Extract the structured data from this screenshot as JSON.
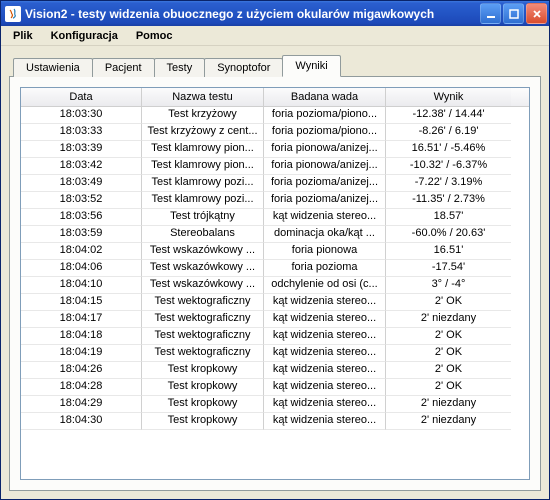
{
  "window": {
    "title": "Vision2 - testy widzenia obuocznego z użyciem okularów migawkowych"
  },
  "menubar": {
    "items": [
      "Plik",
      "Konfiguracja",
      "Pomoc"
    ]
  },
  "tabs": {
    "items": [
      "Ustawienia",
      "Pacjent",
      "Testy",
      "Synoptofor",
      "Wyniki"
    ],
    "activeIndex": 4
  },
  "table": {
    "columns": [
      "Data",
      "Nazwa testu",
      "Badana wada",
      "Wynik"
    ],
    "rows": [
      [
        "18:03:30",
        "Test krzyżowy",
        "foria pozioma/piono...",
        "-12.38' / 14.44'"
      ],
      [
        "18:03:33",
        "Test krzyżowy z cent...",
        "foria pozioma/piono...",
        "-8.26' / 6.19'"
      ],
      [
        "18:03:39",
        "Test klamrowy pion...",
        "foria pionowa/anizej...",
        "16.51' / -5.46%"
      ],
      [
        "18:03:42",
        "Test klamrowy pion...",
        "foria pionowa/anizej...",
        "-10.32' / -6.37%"
      ],
      [
        "18:03:49",
        "Test klamrowy pozi...",
        "foria pozioma/anizej...",
        "-7.22' / 3.19%"
      ],
      [
        "18:03:52",
        "Test klamrowy pozi...",
        "foria pozioma/anizej...",
        "-11.35' / 2.73%"
      ],
      [
        "18:03:56",
        "Test trójkątny",
        "kąt widzenia stereo...",
        "18.57'"
      ],
      [
        "18:03:59",
        "Stereobalans",
        "dominacja oka/kąt ...",
        "-60.0% / 20.63'"
      ],
      [
        "18:04:02",
        "Test wskazówkowy ...",
        "foria pionowa",
        "16.51'"
      ],
      [
        "18:04:06",
        "Test wskazówkowy ...",
        "foria pozioma",
        "-17.54'"
      ],
      [
        "18:04:10",
        "Test wskazówkowy ...",
        "odchylenie od osi (c...",
        "3° / -4°"
      ],
      [
        "18:04:15",
        "Test wektograficzny",
        "kąt widzenia stereo...",
        "2' OK"
      ],
      [
        "18:04:17",
        "Test wektograficzny",
        "kąt widzenia stereo...",
        "2' niezdany"
      ],
      [
        "18:04:18",
        "Test wektograficzny",
        "kąt widzenia stereo...",
        "2' OK"
      ],
      [
        "18:04:19",
        "Test wektograficzny",
        "kąt widzenia stereo...",
        "2' OK"
      ],
      [
        "18:04:26",
        "Test kropkowy",
        "kąt widzenia stereo...",
        "2' OK"
      ],
      [
        "18:04:28",
        "Test kropkowy",
        "kąt widzenia stereo...",
        "2' OK"
      ],
      [
        "18:04:29",
        "Test kropkowy",
        "kąt widzenia stereo...",
        "2' niezdany"
      ],
      [
        "18:04:30",
        "Test kropkowy",
        "kąt widzenia stereo...",
        "2' niezdany"
      ]
    ]
  }
}
